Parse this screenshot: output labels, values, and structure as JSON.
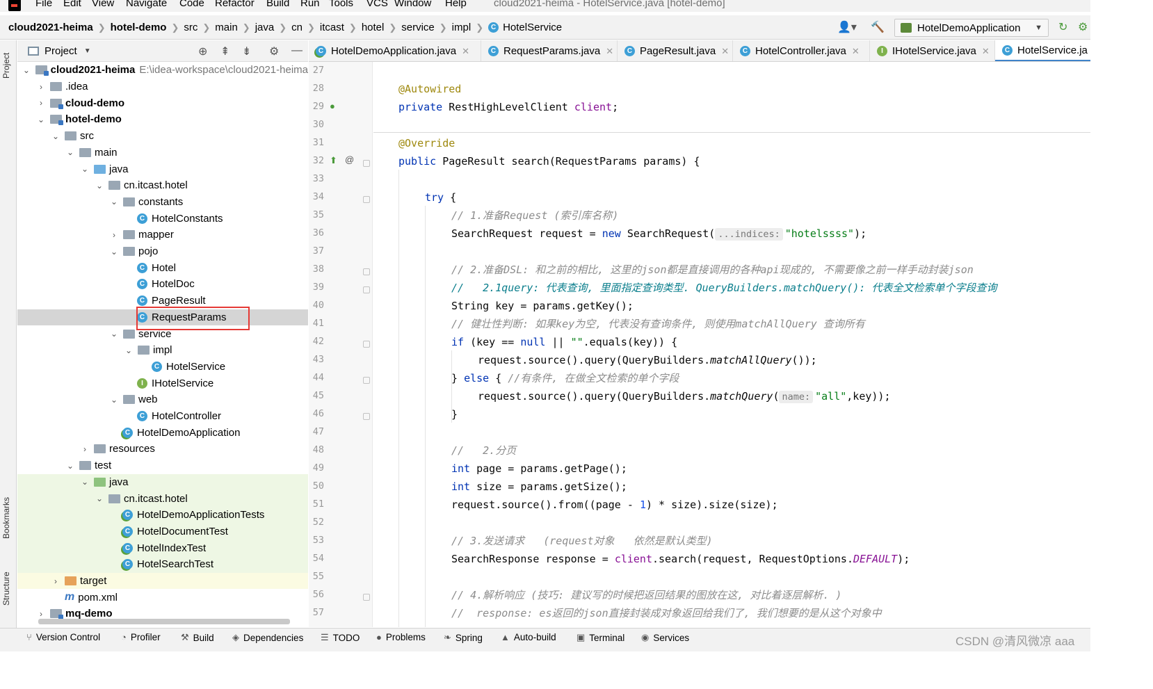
{
  "menu": {
    "items": [
      "File",
      "Edit",
      "View",
      "Navigate",
      "Code",
      "Refactor",
      "Build",
      "Run",
      "Tools",
      "VCS",
      "Window",
      "Help"
    ],
    "window_title": "cloud2021-heima - HotelService.java [hotel-demo]"
  },
  "breadcrumb": {
    "items": [
      "cloud2021-heima",
      "hotel-demo",
      "src",
      "main",
      "java",
      "cn",
      "itcast",
      "hotel",
      "service",
      "impl",
      "HotelService"
    ]
  },
  "run_config": {
    "label": "HotelDemoApplication"
  },
  "left_strip": {
    "project": "Project",
    "bookmarks": "Bookmarks",
    "structure": "Structure"
  },
  "project_panel": {
    "title": "Project"
  },
  "tree": [
    {
      "label": "cloud2021-heima",
      "path": "E:\\idea-workspace\\cloud2021-heima"
    },
    {
      "label": ".idea"
    },
    {
      "label": "cloud-demo"
    },
    {
      "label": "hotel-demo"
    },
    {
      "label": "src"
    },
    {
      "label": "main"
    },
    {
      "label": "java"
    },
    {
      "label": "cn.itcast.hotel"
    },
    {
      "label": "constants"
    },
    {
      "label": "HotelConstants"
    },
    {
      "label": "mapper"
    },
    {
      "label": "pojo"
    },
    {
      "label": "Hotel"
    },
    {
      "label": "HotelDoc"
    },
    {
      "label": "PageResult"
    },
    {
      "label": "RequestParams"
    },
    {
      "label": "service"
    },
    {
      "label": "impl"
    },
    {
      "label": "HotelService"
    },
    {
      "label": "IHotelService"
    },
    {
      "label": "web"
    },
    {
      "label": "HotelController"
    },
    {
      "label": "HotelDemoApplication"
    },
    {
      "label": "resources"
    },
    {
      "label": "test"
    },
    {
      "label": "java"
    },
    {
      "label": "cn.itcast.hotel"
    },
    {
      "label": "HotelDemoApplicationTests"
    },
    {
      "label": "HotelDocumentTest"
    },
    {
      "label": "HotelIndexTest"
    },
    {
      "label": "HotelSearchTest"
    },
    {
      "label": "target"
    },
    {
      "label": "pom.xml"
    },
    {
      "label": "mq-demo"
    }
  ],
  "tabs": [
    {
      "label": "HotelDemoApplication.java"
    },
    {
      "label": "RequestParams.java"
    },
    {
      "label": "PageResult.java"
    },
    {
      "label": "HotelController.java"
    },
    {
      "label": "IHotelService.java"
    },
    {
      "label": "HotelService.ja"
    }
  ],
  "editor": {
    "line_numbers": [
      "27",
      "28",
      "29",
      "30",
      "31",
      "32",
      "33",
      "34",
      "35",
      "36",
      "37",
      "38",
      "39",
      "40",
      "41",
      "42",
      "43",
      "44",
      "45",
      "46",
      "47",
      "48",
      "49",
      "50",
      "51",
      "52",
      "53",
      "54",
      "55",
      "56",
      "57"
    ],
    "code": {
      "l28": "@Autowired",
      "l29a": "private",
      "l29b": " RestHighLevelClient ",
      "l29c": "client",
      "l29d": ";",
      "l31": "@Override",
      "l32a": "public",
      "l32b": " PageResult search(RequestParams params) {",
      "l34a": "try",
      "l34b": " {",
      "l35": "// 1.准备Request (索引库名称)",
      "l36a": "SearchRequest request = ",
      "l36b": "new",
      "l36c": " SearchRequest(",
      "l36hint": "...indices:",
      "l36d": "\"hotelssss\"",
      "l36e": ");",
      "l38": "// 2.准备DSL: 和之前的相比, 这里的json都是直接调用的各种api现成的, 不需要像之前一样手动封装json",
      "l39": "//   2.1query: 代表查询, 里面指定查询类型. QueryBuilders.matchQuery(): 代表全文检索单个字段查询",
      "l40": "String key = params.getKey();",
      "l41": "// 健壮性判断: 如果key为空, 代表没有查询条件, 则使用matchAllQuery 查询所有",
      "l42a": "if",
      "l42b": " (key == ",
      "l42c": "null",
      "l42d": " || ",
      "l42e": "\"\"",
      "l42f": ".equals(key)) {",
      "l43a": "request.source().query(QueryBuilders.",
      "l43b": "matchAllQuery",
      "l43c": "());",
      "l44a": "} ",
      "l44b": "else",
      "l44c": " { ",
      "l44d": "//有条件, 在做全文检索的单个字段",
      "l45a": "request.source().query(QueryBuilders.",
      "l45b": "matchQuery",
      "l45c": "(",
      "l45hint": "name:",
      "l45d": "\"all\"",
      "l45e": ",key));",
      "l46": "}",
      "l48": "//   2.分页",
      "l49a": "int",
      "l49b": " page = params.getPage();",
      "l50a": "int",
      "l50b": " size = params.getSize();",
      "l51a": "request.source().from((page - ",
      "l51b": "1",
      "l51c": ") * size).size(size);",
      "l53": "// 3.发送请求   (request对象   依然是默认类型)",
      "l54a": "SearchResponse response = ",
      "l54b": "client",
      "l54c": ".search(request, RequestOptions.",
      "l54d": "DEFAULT",
      "l54e": ");",
      "l56": "// 4.解析响应 (技巧: 建议写的时候把返回结果的图放在这, 对比着逐层解析. )",
      "l57": "//  response: es返回的json直接封装成对象返回给我们了, 我们想要的是从这个对象中"
    }
  },
  "bottom_tools": [
    "Version Control",
    "Profiler",
    "Build",
    "Dependencies",
    "TODO",
    "Problems",
    "Spring",
    "Auto-build",
    "Terminal",
    "Services"
  ],
  "watermark": "CSDN @清风微凉 aaa",
  "colors": {
    "accent": "#4083c9",
    "highlight_box": "#e53935",
    "keyword": "#0033b3",
    "annotation": "#9e880d",
    "string": "#067d17"
  }
}
